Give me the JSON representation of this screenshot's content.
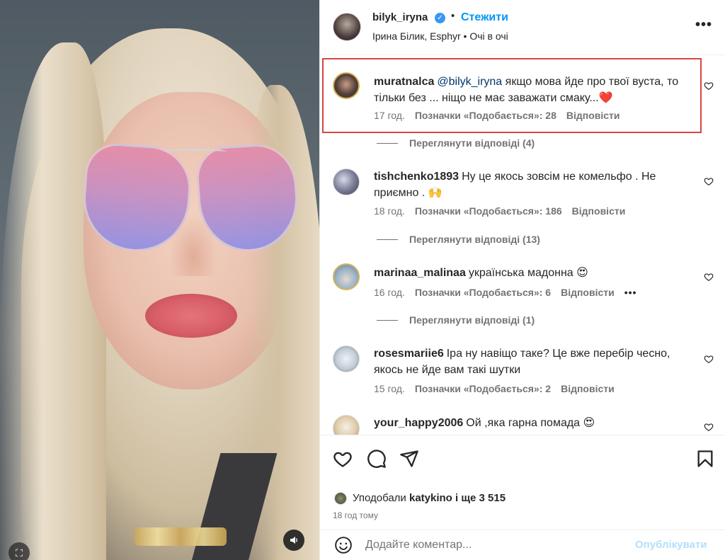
{
  "header": {
    "username": "bilyk_iryna",
    "separator": "•",
    "follow_label": "Стежити",
    "subtitle": "Ірина Білик, Esphyr • Очі в очі"
  },
  "comments": [
    {
      "user": "muratnalca",
      "mention": "@bilyk_iryna",
      "text": " якщо мова йде про твої вуста, то тільки без ... ніщо не має заважати смаку...",
      "emoji": "❤️",
      "time": "17 год.",
      "likes": "Позначки «Подобається»: 28",
      "reply": "Відповісти",
      "view_replies": "Переглянути відповіді (4)"
    },
    {
      "user": "tishchenko1893",
      "text": "Ну це якось зовсім не комельфо . Не приємно . ",
      "emoji": "🙌",
      "time": "18 год.",
      "likes": "Позначки «Подобається»: 186",
      "reply": "Відповісти",
      "view_replies": "Переглянути відповіді (13)"
    },
    {
      "user": "marinaa_malinaa",
      "text": "українська мадонна ",
      "emoji": "😍",
      "time": "16 год.",
      "likes": "Позначки «Подобається»: 6",
      "reply": "Відповісти",
      "more": "•••",
      "view_replies": "Переглянути відповіді (1)"
    },
    {
      "user": "rosesmariie6",
      "text": "Іра ну навіщо таке? Це вже перебір чесно, якось не йде вам такі шутки",
      "time": "15 год.",
      "likes": "Позначки «Подобається»: 2",
      "reply": "Відповісти"
    },
    {
      "user": "your_happy2006",
      "text": "Ой ,яка гарна помада ",
      "emoji": "😍"
    }
  ],
  "likes": {
    "prefix": "Уподобали ",
    "user": "katykino",
    "suffix": " і ще 3 515"
  },
  "time_ago": "18 год тому",
  "add_comment": {
    "placeholder": "Додайте коментар...",
    "publish_label": "Опублікувати"
  },
  "colors": {
    "accent": "#0095f6",
    "highlight_border": "#d9453f",
    "muted_text": "#737373"
  }
}
